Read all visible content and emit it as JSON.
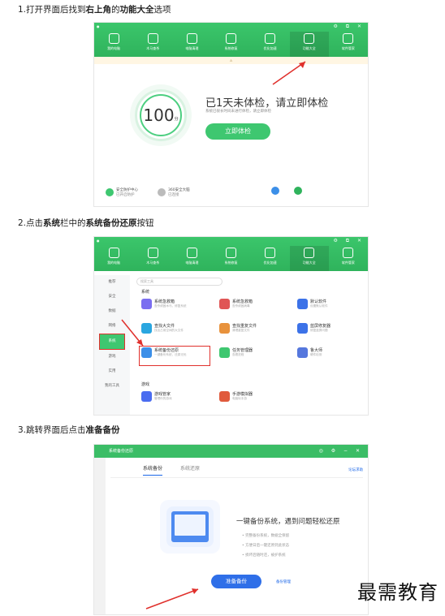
{
  "steps": [
    {
      "pre": "1.打开界面后找到",
      "bold1": "右上角",
      "mid": "的",
      "bold2": "功能大全",
      "post": "选项"
    },
    {
      "pre": "2.点击",
      "bold1": "系统",
      "mid": "栏中的",
      "bold2": "系统备份还原",
      "post": "按钮"
    },
    {
      "pre": "3.跳转界面后点击",
      "bold1": "准备备份",
      "mid": "",
      "bold2": "",
      "post": ""
    }
  ],
  "toolbar": {
    "labels": [
      "我的电脑",
      "木马查杀",
      "电脑清理",
      "系统修复",
      "优化加速",
      "功能大全",
      "软件管家"
    ]
  },
  "shot1": {
    "score": "100",
    "score_unit": "分",
    "headline": "已1天未体检，请立即体检",
    "subline": "系统已很长时间未进行体检，请立即体检",
    "button": "立即体检",
    "features": [
      "安全防护中心",
      "360安全大脑"
    ],
    "feature_status": [
      "已开启防护",
      "已连接"
    ]
  },
  "shot2": {
    "sidebar": [
      "推荐",
      "安全",
      "数据",
      "网络",
      "系统",
      "游戏",
      "实用",
      "我的工具"
    ],
    "search_placeholder": "搜索工具",
    "category_system": "系统",
    "category_game": "游戏",
    "items": [
      {
        "title": "系统急救箱",
        "desc": "查杀顽固木马，修复系统"
      },
      {
        "title": "系统急救箱",
        "desc": "查杀顽固病毒"
      },
      {
        "title": "默认软件",
        "desc": "设置默认软件"
      },
      {
        "title": "查找大文件",
        "desc": "找出占用空间的大文件"
      },
      {
        "title": "查找重复文件",
        "desc": "清理重复文件"
      },
      {
        "title": "蓝屏修复器",
        "desc": "修复蓝屏问题"
      },
      {
        "title": "系统备份还原",
        "desc": "一键备份系统，还原无忧"
      },
      {
        "title": "任务管理器",
        "desc": "查看进程"
      },
      {
        "title": "鲁大师",
        "desc": "硬件检测"
      }
    ],
    "game_items": [
      {
        "title": "游戏管家",
        "desc": "管理你的游戏"
      },
      {
        "title": "手游模拟器",
        "desc": "电脑玩手游"
      }
    ]
  },
  "shot3": {
    "title": "系统备份还原",
    "tabs": [
      "系统备份",
      "系统还原"
    ],
    "help": "论坛求助",
    "headline": "一键备份系统，遇到问题轻松还原",
    "bullets": [
      "• 完整备份系统，数据全保留",
      "• 方便日后一键还原到此状态",
      "• 损坏后随时还，被护系统"
    ],
    "button": "准备备份",
    "manage": "备份管理"
  },
  "watermark": "最需教育",
  "colors": {
    "green": "#3ec770",
    "blue": "#2f6fe8",
    "red": "#e0302c"
  }
}
